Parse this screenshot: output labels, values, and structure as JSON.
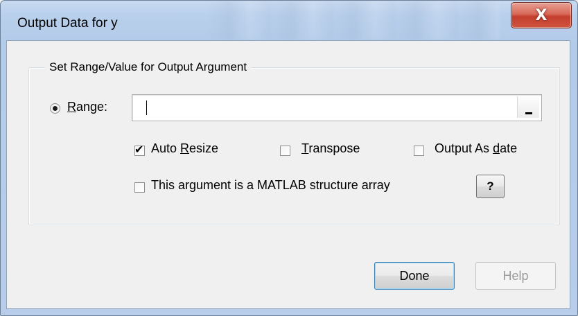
{
  "window": {
    "title": "Output Data for y",
    "close_label": "X"
  },
  "group": {
    "title": "Set Range/Value for Output Argument"
  },
  "range": {
    "label_first": "R",
    "label_rest": "ange:",
    "value": "",
    "selected": true
  },
  "options": {
    "auto_resize": {
      "pre": "Auto ",
      "underline": "R",
      "post": "esize",
      "checked": true
    },
    "transpose": {
      "pre": "",
      "underline": "T",
      "post": "ranspose",
      "checked": false
    },
    "output_as_date": {
      "pre": "Output As ",
      "underline": "d",
      "post": "ate",
      "checked": false
    },
    "structure_array": {
      "label": "This argument is a MATLAB structure array",
      "checked": false
    }
  },
  "buttons": {
    "question": "?",
    "done": "Done",
    "help": "Help"
  }
}
